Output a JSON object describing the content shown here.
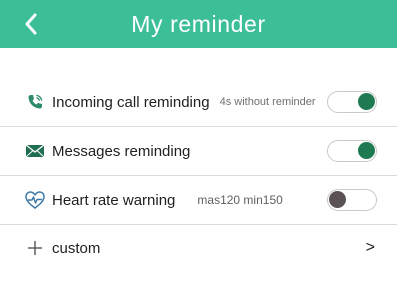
{
  "header": {
    "title": "My reminder",
    "back_icon": "chevron-left-icon",
    "background": "#3cbe97"
  },
  "settings": [
    {
      "icon": "phone-icon",
      "label": "Incoming call reminding",
      "hint": "4s without reminder",
      "toggle_on": true
    },
    {
      "icon": "envelope-icon",
      "label": "Messages reminding",
      "hint": "",
      "toggle_on": true
    },
    {
      "icon": "heart-pulse-icon",
      "label": "Heart rate warning",
      "hint": "mas120 min150",
      "toggle_on": false
    }
  ],
  "custom": {
    "icon": "plus-icon",
    "label": "custom",
    "chevron": ">"
  },
  "colors": {
    "accent": "#3cbe97",
    "toggle_on_knob": "#1f7a52",
    "toggle_off_knob": "#5b5256"
  }
}
